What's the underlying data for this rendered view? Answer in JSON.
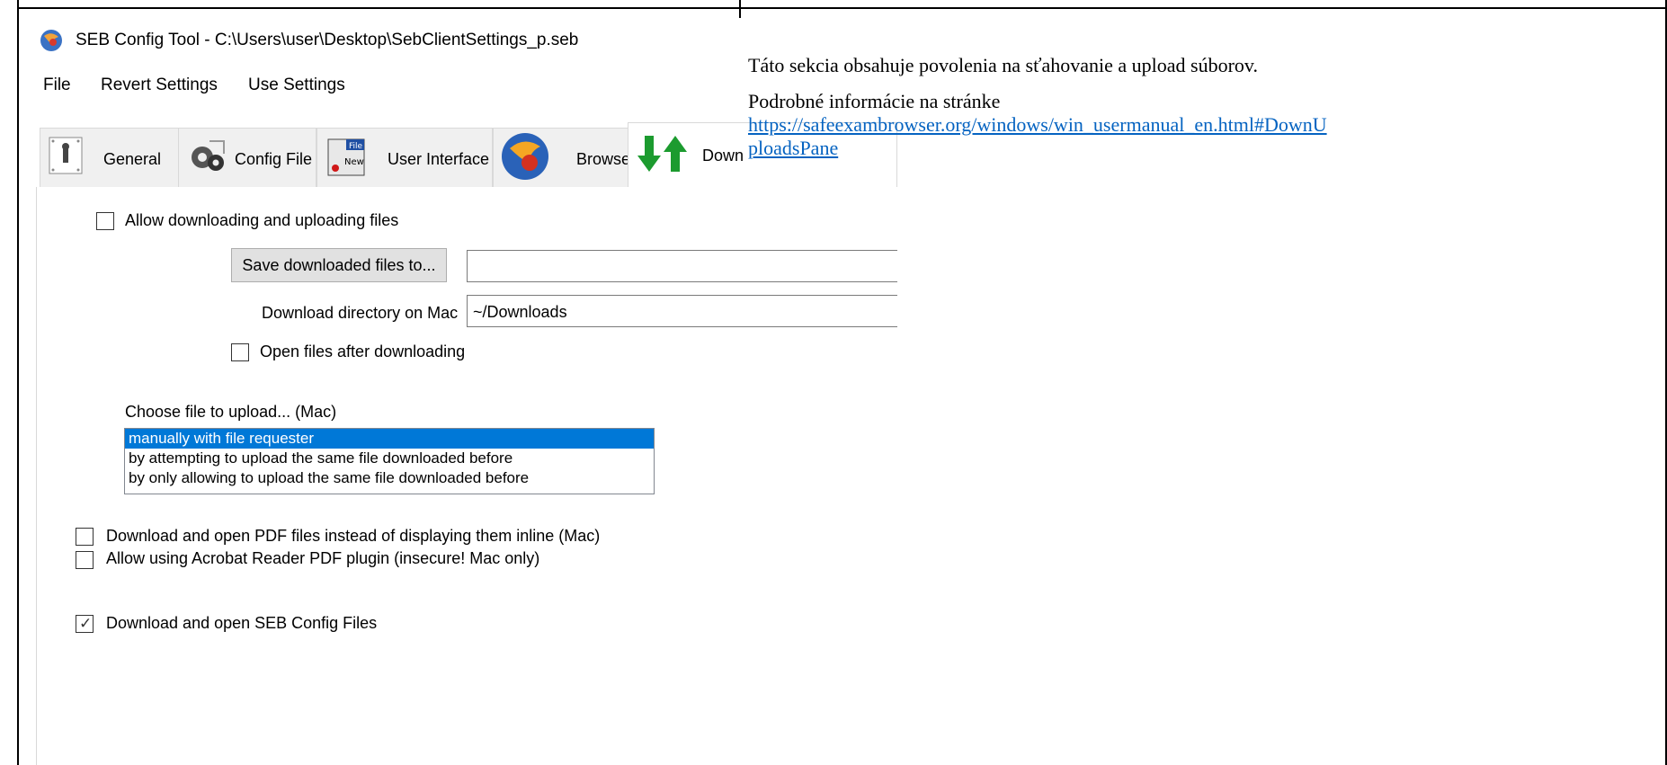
{
  "window": {
    "title": "SEB Config Tool - C:\\Users\\user\\Desktop\\SebClientSettings_p.seb"
  },
  "menu": {
    "items": [
      "File",
      "Revert Settings",
      "Use Settings"
    ]
  },
  "tabs": [
    {
      "label": "General",
      "icon": "general-icon"
    },
    {
      "label": "Config File",
      "icon": "config-file-icon"
    },
    {
      "label": "User Interface",
      "icon": "user-interface-icon"
    },
    {
      "label": "Browser",
      "icon": "browser-icon"
    },
    {
      "label": "Down",
      "icon": "down-up-arrows-icon"
    }
  ],
  "down_uploads": {
    "allow_label": "Allow downloading and uploading files",
    "allow_checked": false,
    "save_button_label": "Save downloaded files to...",
    "save_path_value": "",
    "mac_dir_label": "Download directory on Mac",
    "mac_dir_value": "~/Downloads",
    "open_after_label": "Open files after downloading",
    "open_after_checked": false,
    "choose_upload_label": "Choose file to upload... (Mac)",
    "upload_options": [
      "manually with file requester",
      "by attempting to upload the same file downloaded before",
      "by only allowing to upload the same file downloaded before"
    ],
    "upload_selected_index": 0,
    "pdf_label": "Download and open PDF files instead of displaying them inline (Mac)",
    "pdf_checked": false,
    "acrobat_label": "Allow using Acrobat Reader PDF plugin (insecure! Mac only)",
    "acrobat_checked": false,
    "seb_config_label": "Download and open SEB Config Files",
    "seb_config_checked": true
  },
  "description": {
    "paragraph1": "Táto sekcia obsahuje povolenia na sťahovanie a upload súborov.",
    "paragraph2": "Podrobné informácie na stránke",
    "link_line1": "https://safeexambrowser.org/windows/win_usermanual_en.html#DownU",
    "link_line2": "ploadsPane"
  },
  "colors": {
    "selection": "#0078d7",
    "link": "#0563c1",
    "tab_inactive": "#f0f0f0"
  }
}
